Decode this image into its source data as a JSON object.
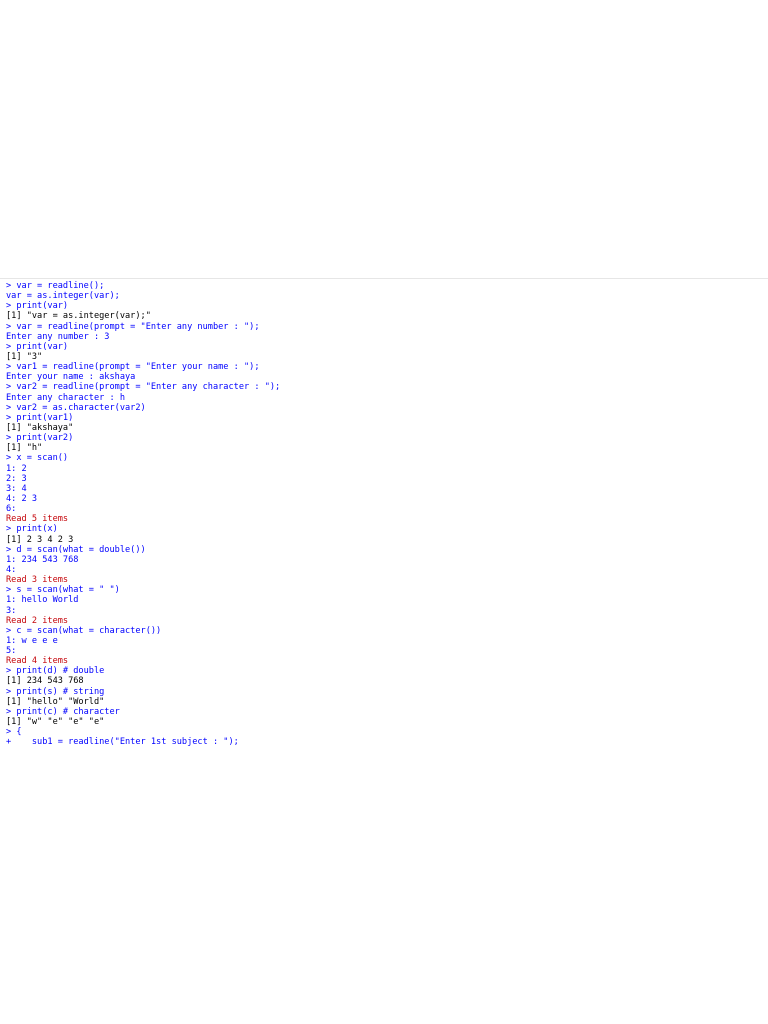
{
  "console": {
    "colors": {
      "input": "#0000ff",
      "output": "#000000",
      "message": "#c5060b"
    },
    "lines": [
      {
        "kind": "input",
        "text": "> var = readline();"
      },
      {
        "kind": "input",
        "text": "var = as.integer(var);"
      },
      {
        "kind": "input",
        "text": "> print(var)"
      },
      {
        "kind": "output",
        "text": "[1] \"var = as.integer(var);\""
      },
      {
        "kind": "input",
        "text": "> var = readline(prompt = \"Enter any number : \");"
      },
      {
        "kind": "input",
        "text": "Enter any number : 3"
      },
      {
        "kind": "input",
        "text": "> print(var)"
      },
      {
        "kind": "output",
        "text": "[1] \"3\""
      },
      {
        "kind": "input",
        "text": "> var1 = readline(prompt = \"Enter your name : \");"
      },
      {
        "kind": "input",
        "text": "Enter your name : akshaya"
      },
      {
        "kind": "input",
        "text": "> var2 = readline(prompt = \"Enter any character : \");"
      },
      {
        "kind": "input",
        "text": "Enter any character : h"
      },
      {
        "kind": "input",
        "text": "> var2 = as.character(var2)"
      },
      {
        "kind": "input",
        "text": "> print(var1)"
      },
      {
        "kind": "output",
        "text": "[1] \"akshaya\""
      },
      {
        "kind": "input",
        "text": "> print(var2)"
      },
      {
        "kind": "output",
        "text": "[1] \"h\""
      },
      {
        "kind": "input",
        "text": "> x = scan()"
      },
      {
        "kind": "input",
        "text": "1: 2"
      },
      {
        "kind": "input",
        "text": "2: 3"
      },
      {
        "kind": "input",
        "text": "3: 4"
      },
      {
        "kind": "input",
        "text": "4: 2 3"
      },
      {
        "kind": "input",
        "text": "6:"
      },
      {
        "kind": "message",
        "text": "Read 5 items"
      },
      {
        "kind": "input",
        "text": "> print(x)"
      },
      {
        "kind": "output",
        "text": "[1] 2 3 4 2 3"
      },
      {
        "kind": "input",
        "text": "> d = scan(what = double())"
      },
      {
        "kind": "input",
        "text": "1: 234 543 768"
      },
      {
        "kind": "input",
        "text": "4:"
      },
      {
        "kind": "message",
        "text": "Read 3 items"
      },
      {
        "kind": "input",
        "text": "> s = scan(what = \" \")"
      },
      {
        "kind": "input",
        "text": "1: hello World"
      },
      {
        "kind": "input",
        "text": "3:"
      },
      {
        "kind": "message",
        "text": "Read 2 items"
      },
      {
        "kind": "input",
        "text": "> c = scan(what = character())"
      },
      {
        "kind": "input",
        "text": "1: w e e e"
      },
      {
        "kind": "input",
        "text": "5:"
      },
      {
        "kind": "message",
        "text": "Read 4 items"
      },
      {
        "kind": "input",
        "text": "> print(d) # double"
      },
      {
        "kind": "output",
        "text": "[1] 234 543 768"
      },
      {
        "kind": "input",
        "text": "> print(s) # string"
      },
      {
        "kind": "output",
        "text": "[1] \"hello\" \"World\""
      },
      {
        "kind": "input",
        "text": "> print(c) # character"
      },
      {
        "kind": "output",
        "text": "[1] \"w\" \"e\" \"e\" \"e\""
      },
      {
        "kind": "input",
        "text": "> {"
      },
      {
        "kind": "input",
        "text": "+    sub1 = readline(\"Enter 1st subject : \");"
      }
    ]
  }
}
